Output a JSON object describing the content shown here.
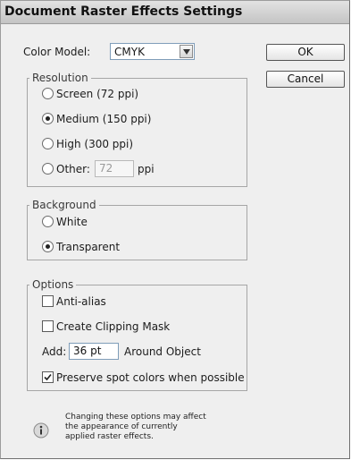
{
  "dialog": {
    "title": "Document Raster Effects Settings"
  },
  "color_model": {
    "label": "Color Model:",
    "value": "CMYK"
  },
  "buttons": {
    "ok": "OK",
    "cancel": "Cancel"
  },
  "resolution": {
    "legend": "Resolution",
    "options": [
      "Screen (72 ppi)",
      "Medium (150 ppi)",
      "High (300 ppi)",
      "Other:"
    ],
    "selected": "Medium (150 ppi)",
    "other_value": "72",
    "other_unit": "ppi"
  },
  "background": {
    "legend": "Background",
    "options": [
      "White",
      "Transparent"
    ],
    "selected": "Transparent"
  },
  "options": {
    "legend": "Options",
    "anti_alias": {
      "label": "Anti-alias",
      "checked": false
    },
    "clipping_mask": {
      "label": "Create Clipping Mask",
      "checked": false
    },
    "add_label": "Add:",
    "add_value": "36 pt",
    "around_label": "Around Object",
    "preserve_spot": {
      "label": "Preserve spot colors when possible",
      "checked": true
    }
  },
  "note": {
    "lines": [
      "Changing these options may affect",
      "the appearance of currently",
      "applied raster effects."
    ]
  }
}
